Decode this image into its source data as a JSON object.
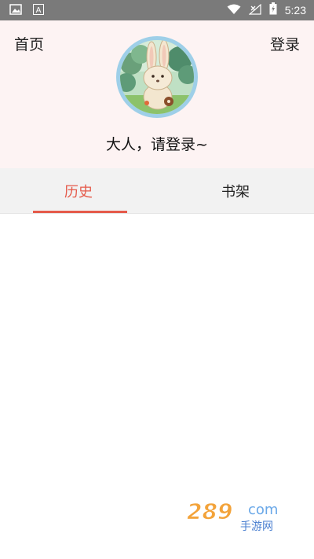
{
  "status_bar": {
    "time": "5:23",
    "icons": [
      "image-icon",
      "text-icon",
      "wifi-icon",
      "signal-icon",
      "battery-icon"
    ]
  },
  "header": {
    "left_nav": "首页",
    "right_nav": "登录",
    "greeting": "大人，请登录~"
  },
  "tabs": [
    {
      "label": "历史",
      "active": true
    },
    {
      "label": "书架",
      "active": false
    }
  ],
  "watermark": {
    "brand": "289",
    "domain": "com",
    "sub": "手游网"
  },
  "colors": {
    "accent": "#e55a4a",
    "header_bg": "#fdf3f3",
    "avatar_ring": "#9ecfe8",
    "status_bar": "#7a7a7a"
  }
}
